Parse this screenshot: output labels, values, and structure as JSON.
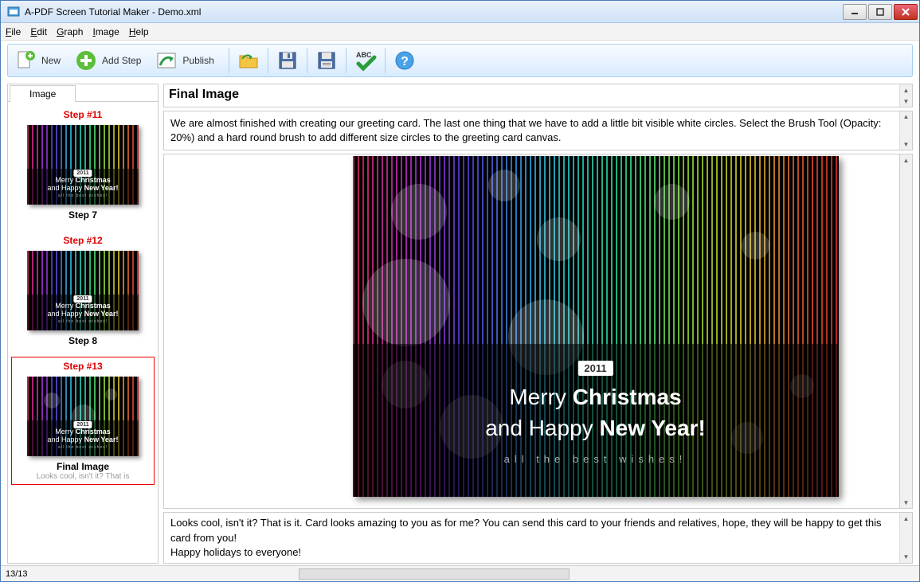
{
  "window": {
    "title": "A-PDF Screen Tutorial Maker - Demo.xml"
  },
  "menu": {
    "file": "File",
    "edit": "Edit",
    "graph": "Graph",
    "image": "Image",
    "help": "Help"
  },
  "toolbar": {
    "new_label": "New",
    "addstep_label": "Add Step",
    "publish_label": "Publish"
  },
  "sidebar": {
    "tab_label": "Image",
    "items": [
      {
        "step_num": "Step #11",
        "label": "Step 7"
      },
      {
        "step_num": "Step #12",
        "label": "Step 8"
      },
      {
        "step_num": "Step #13",
        "label": "Final Image",
        "sub": "Looks cool, isn't it? That is"
      }
    ]
  },
  "main": {
    "title": "Final Image",
    "description": "We are almost finished with creating our greeting card. The last one thing that we have to add a little bit visible white circles. Select the Brush Tool (Opacity: 20%) and a hard round brush to add different size circles to the greeting card canvas.",
    "footer_line1": "Looks cool, isn't it? That is it. Card looks amazing to you as for me? You can send this card to your friends and relatives, hope, they will be happy to get this card from you!",
    "footer_line2": "Happy holidays to everyone!"
  },
  "card": {
    "year": "2011",
    "line1_a": "Merry ",
    "line1_b": "Christmas",
    "line2_a": "and Happy ",
    "line2_b": "New Year!",
    "wishes": "all the best wishes!"
  },
  "status": {
    "counter": "13/13"
  }
}
